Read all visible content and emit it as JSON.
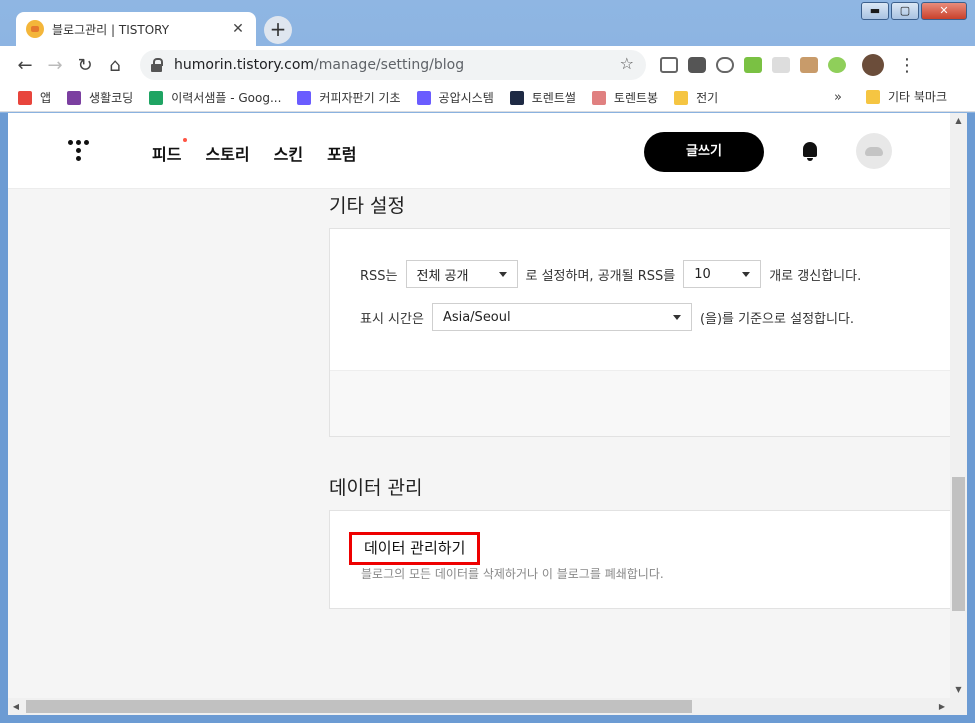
{
  "browser": {
    "tab_title": "블로그관리 | TISTORY",
    "tab_close": "✕",
    "new_tab": "+",
    "url_host": "humorin.tistory.com",
    "url_path": "/manage/setting/blog",
    "minimize": "▬",
    "maximize": "▢",
    "close": "✕"
  },
  "bookmarks": {
    "items": [
      {
        "label": "앱",
        "color": "#e8453c"
      },
      {
        "label": "생활코딩",
        "color": "#7b3fa0"
      },
      {
        "label": "이력서샘플 - Goog...",
        "color": "#1fa463"
      },
      {
        "label": "커피자판기 기초",
        "color": "#6a5cff"
      },
      {
        "label": "공압시스템",
        "color": "#6a5cff"
      },
      {
        "label": "토렌트썰",
        "color": "#1e2a44"
      },
      {
        "label": "토렌트봉",
        "color": "#e08080"
      },
      {
        "label": "전기",
        "color": "#f5c542"
      }
    ],
    "more": "»",
    "other": "기타 북마크"
  },
  "header": {
    "nav": [
      "피드",
      "스토리",
      "스킨",
      "포럼"
    ],
    "write_button": "글쓰기"
  },
  "misc_settings": {
    "title": "기타 설정",
    "rss_prefix": "RSS는",
    "rss_visibility": "전체 공개",
    "rss_middle": "로 설정하며, 공개될 RSS를",
    "rss_count": "10",
    "rss_suffix": "개로 갱신합니다.",
    "time_prefix": "표시 시간은",
    "timezone": "Asia/Seoul",
    "time_suffix": "(을)를 기준으로 설정합니다."
  },
  "data_management": {
    "title": "데이터 관리",
    "link": "데이터 관리하기",
    "description": "블로그의 모든 데이터를 삭제하거나 이 블로그를 폐쇄합니다."
  }
}
